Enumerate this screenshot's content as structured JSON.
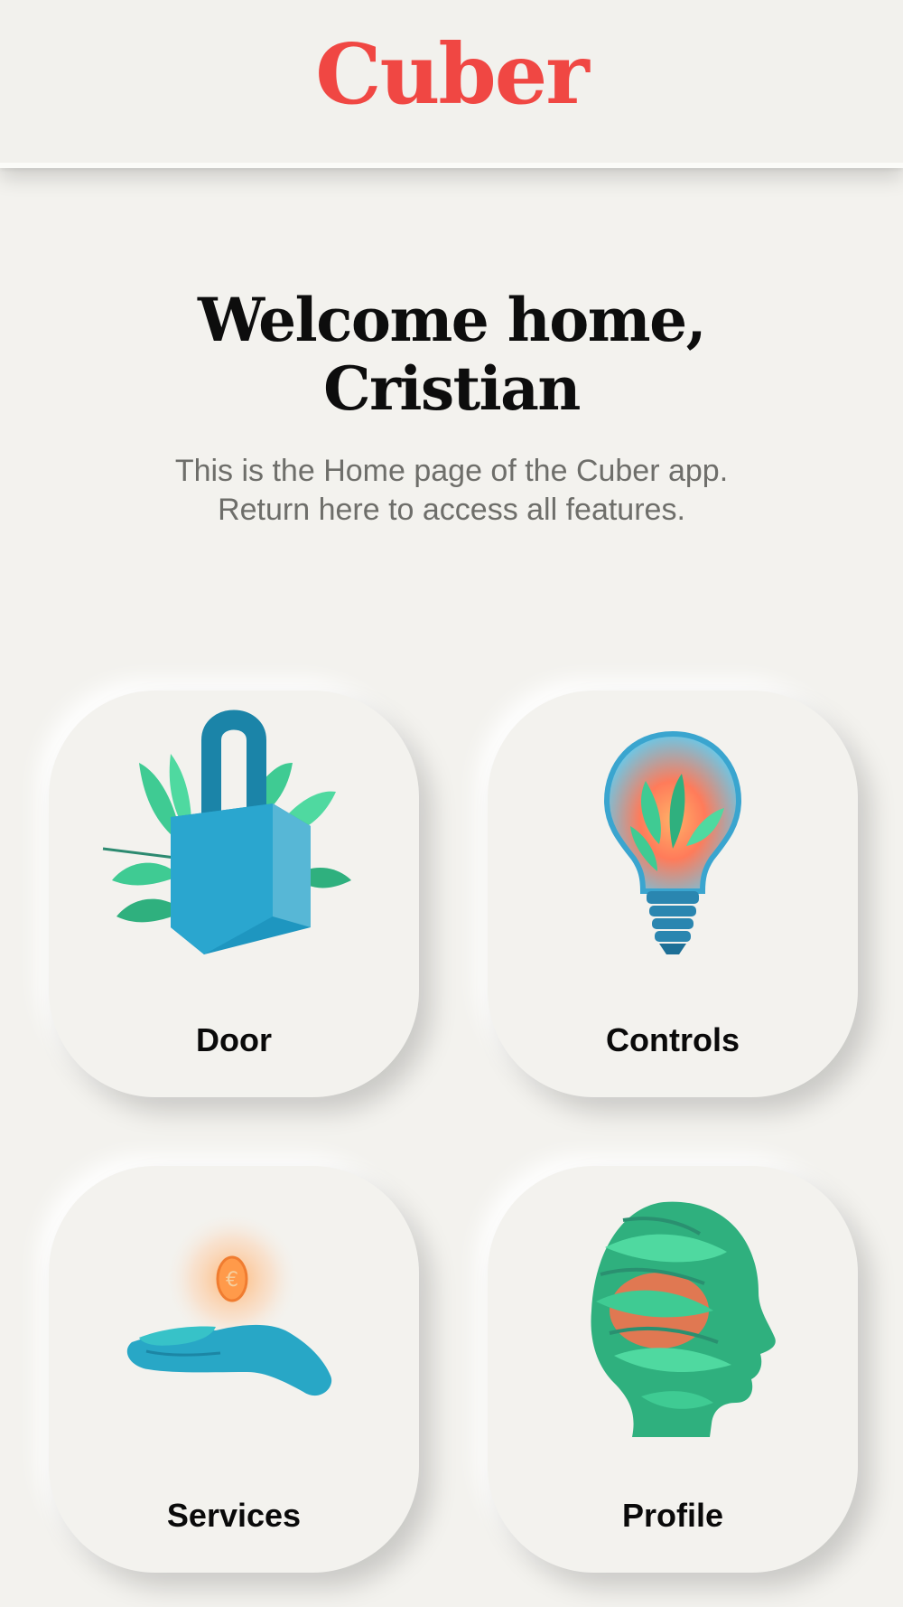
{
  "app": {
    "brand": "Cuber",
    "brand_color": "#f04743"
  },
  "welcome": {
    "title_line1": "Welcome home,",
    "title_line2": "Cristian",
    "subtitle_line1": "This is the Home page of the Cuber app.",
    "subtitle_line2": "Return here to access all features."
  },
  "tiles": [
    {
      "label": "Door",
      "icon": "padlock-with-leaves-icon"
    },
    {
      "label": "Controls",
      "icon": "lightbulb-with-plants-icon"
    },
    {
      "label": "Services",
      "icon": "hand-with-euro-coin-icon"
    },
    {
      "label": "Profile",
      "icon": "leafy-head-icon"
    }
  ],
  "colors": {
    "background": "#f3f2ee",
    "illustration_teal": "#2a9fc4",
    "illustration_green": "#3fcb93",
    "illustration_orange": "#ff8a45"
  }
}
